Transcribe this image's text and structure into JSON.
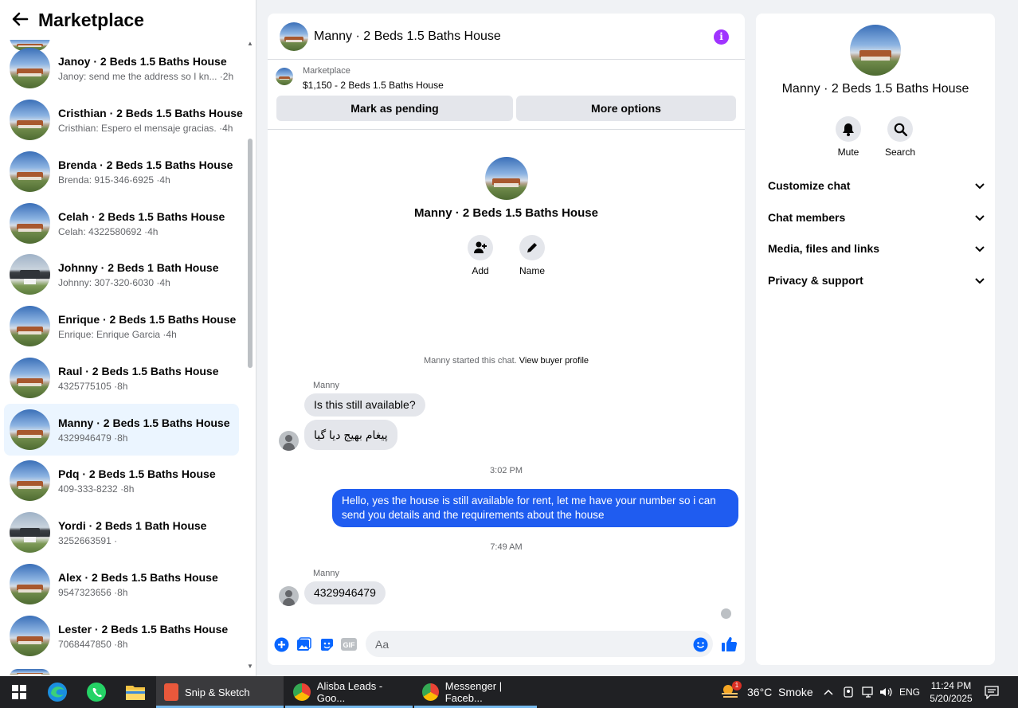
{
  "sidebar": {
    "title": "Marketplace",
    "conversations": [
      {
        "name": "Janoy · 2 Beds 1.5 Baths House",
        "snippet": "Janoy: send me the address so I kn... ·2h",
        "dark": false
      },
      {
        "name": "Cristhian · 2 Beds 1.5 Baths House",
        "snippet": "Cristhian: Espero el mensaje gracias. ·4h",
        "dark": false
      },
      {
        "name": "Brenda · 2 Beds 1.5 Baths House",
        "snippet": "Brenda: 915-346-6925 ·4h",
        "dark": false
      },
      {
        "name": "Celah · 2 Beds 1.5 Baths House",
        "snippet": "Celah: 4322580692 ·4h",
        "dark": false
      },
      {
        "name": "Johnny · 2 Beds 1 Bath House",
        "snippet": "Johnny: 307-320-6030 ·4h",
        "dark": true
      },
      {
        "name": "Enrique · 2 Beds 1.5 Baths House",
        "snippet": "Enrique: Enrique Garcia ·4h",
        "dark": false
      },
      {
        "name": "Raul · 2 Beds 1.5 Baths House",
        "snippet": "4325775105 ·8h",
        "dark": false
      },
      {
        "name": "Manny · 2 Beds 1.5 Baths House",
        "snippet": "4329946479 ·8h",
        "dark": false,
        "active": true
      },
      {
        "name": "Pdq · 2 Beds 1.5 Baths House",
        "snippet": "409-333-8232 ·8h",
        "dark": false
      },
      {
        "name": "Yordi · 2 Beds 1 Bath House",
        "snippet": "3252663591 ·",
        "dark": true
      },
      {
        "name": "Alex · 2 Beds 1.5 Baths House",
        "snippet": "9547323656 ·8h",
        "dark": false
      },
      {
        "name": "Lester · 2 Beds 1.5 Baths House",
        "snippet": "7068447850 ·8h",
        "dark": false
      }
    ]
  },
  "chat": {
    "title": "Manny · 2 Beds 1.5 Baths House",
    "listing_source": "Marketplace",
    "listing_price": "$1,150 - 2 Beds 1.5 Baths House",
    "mark_pending_label": "Mark as pending",
    "more_options_label": "More options",
    "intro_title": "Manny · 2 Beds 1.5 Baths House",
    "add_label": "Add",
    "name_label": "Name",
    "started_text": "Manny started this chat.",
    "view_profile_label": "View buyer profile",
    "sender_1": "Manny",
    "msg_1": "Is this still available?",
    "msg_2": "پیغام بھیج دیا گیا",
    "time_1": "3:02 PM",
    "msg_out": "Hello, yes the house is still available for rent, let me have your number so i can send you details and the requirements about the house",
    "time_2": "7:49 AM",
    "sender_2": "Manny",
    "msg_3": "4329946479",
    "input_placeholder": "Aa",
    "gif_label": "GIF"
  },
  "details": {
    "title": "Manny · 2 Beds 1.5 Baths House",
    "mute_label": "Mute",
    "search_label": "Search",
    "sections": [
      "Customize chat",
      "Chat members",
      "Media, files and links",
      "Privacy & support"
    ]
  },
  "taskbar": {
    "apps": [
      {
        "label": "Snip & Sketch",
        "active": true
      },
      {
        "label": "Alisba Leads - Goo...",
        "active": false
      },
      {
        "label": "Messenger | Faceb...",
        "active": false
      }
    ],
    "weather": "36°C  Smoke",
    "weather_badge": "1",
    "lang": "ENG",
    "time": "11:24 PM",
    "date": "5/20/2025"
  },
  "colors": {
    "accent": "#0866ff",
    "outgoing_bubble": "#1f5cf0",
    "info": "#a033ff"
  }
}
